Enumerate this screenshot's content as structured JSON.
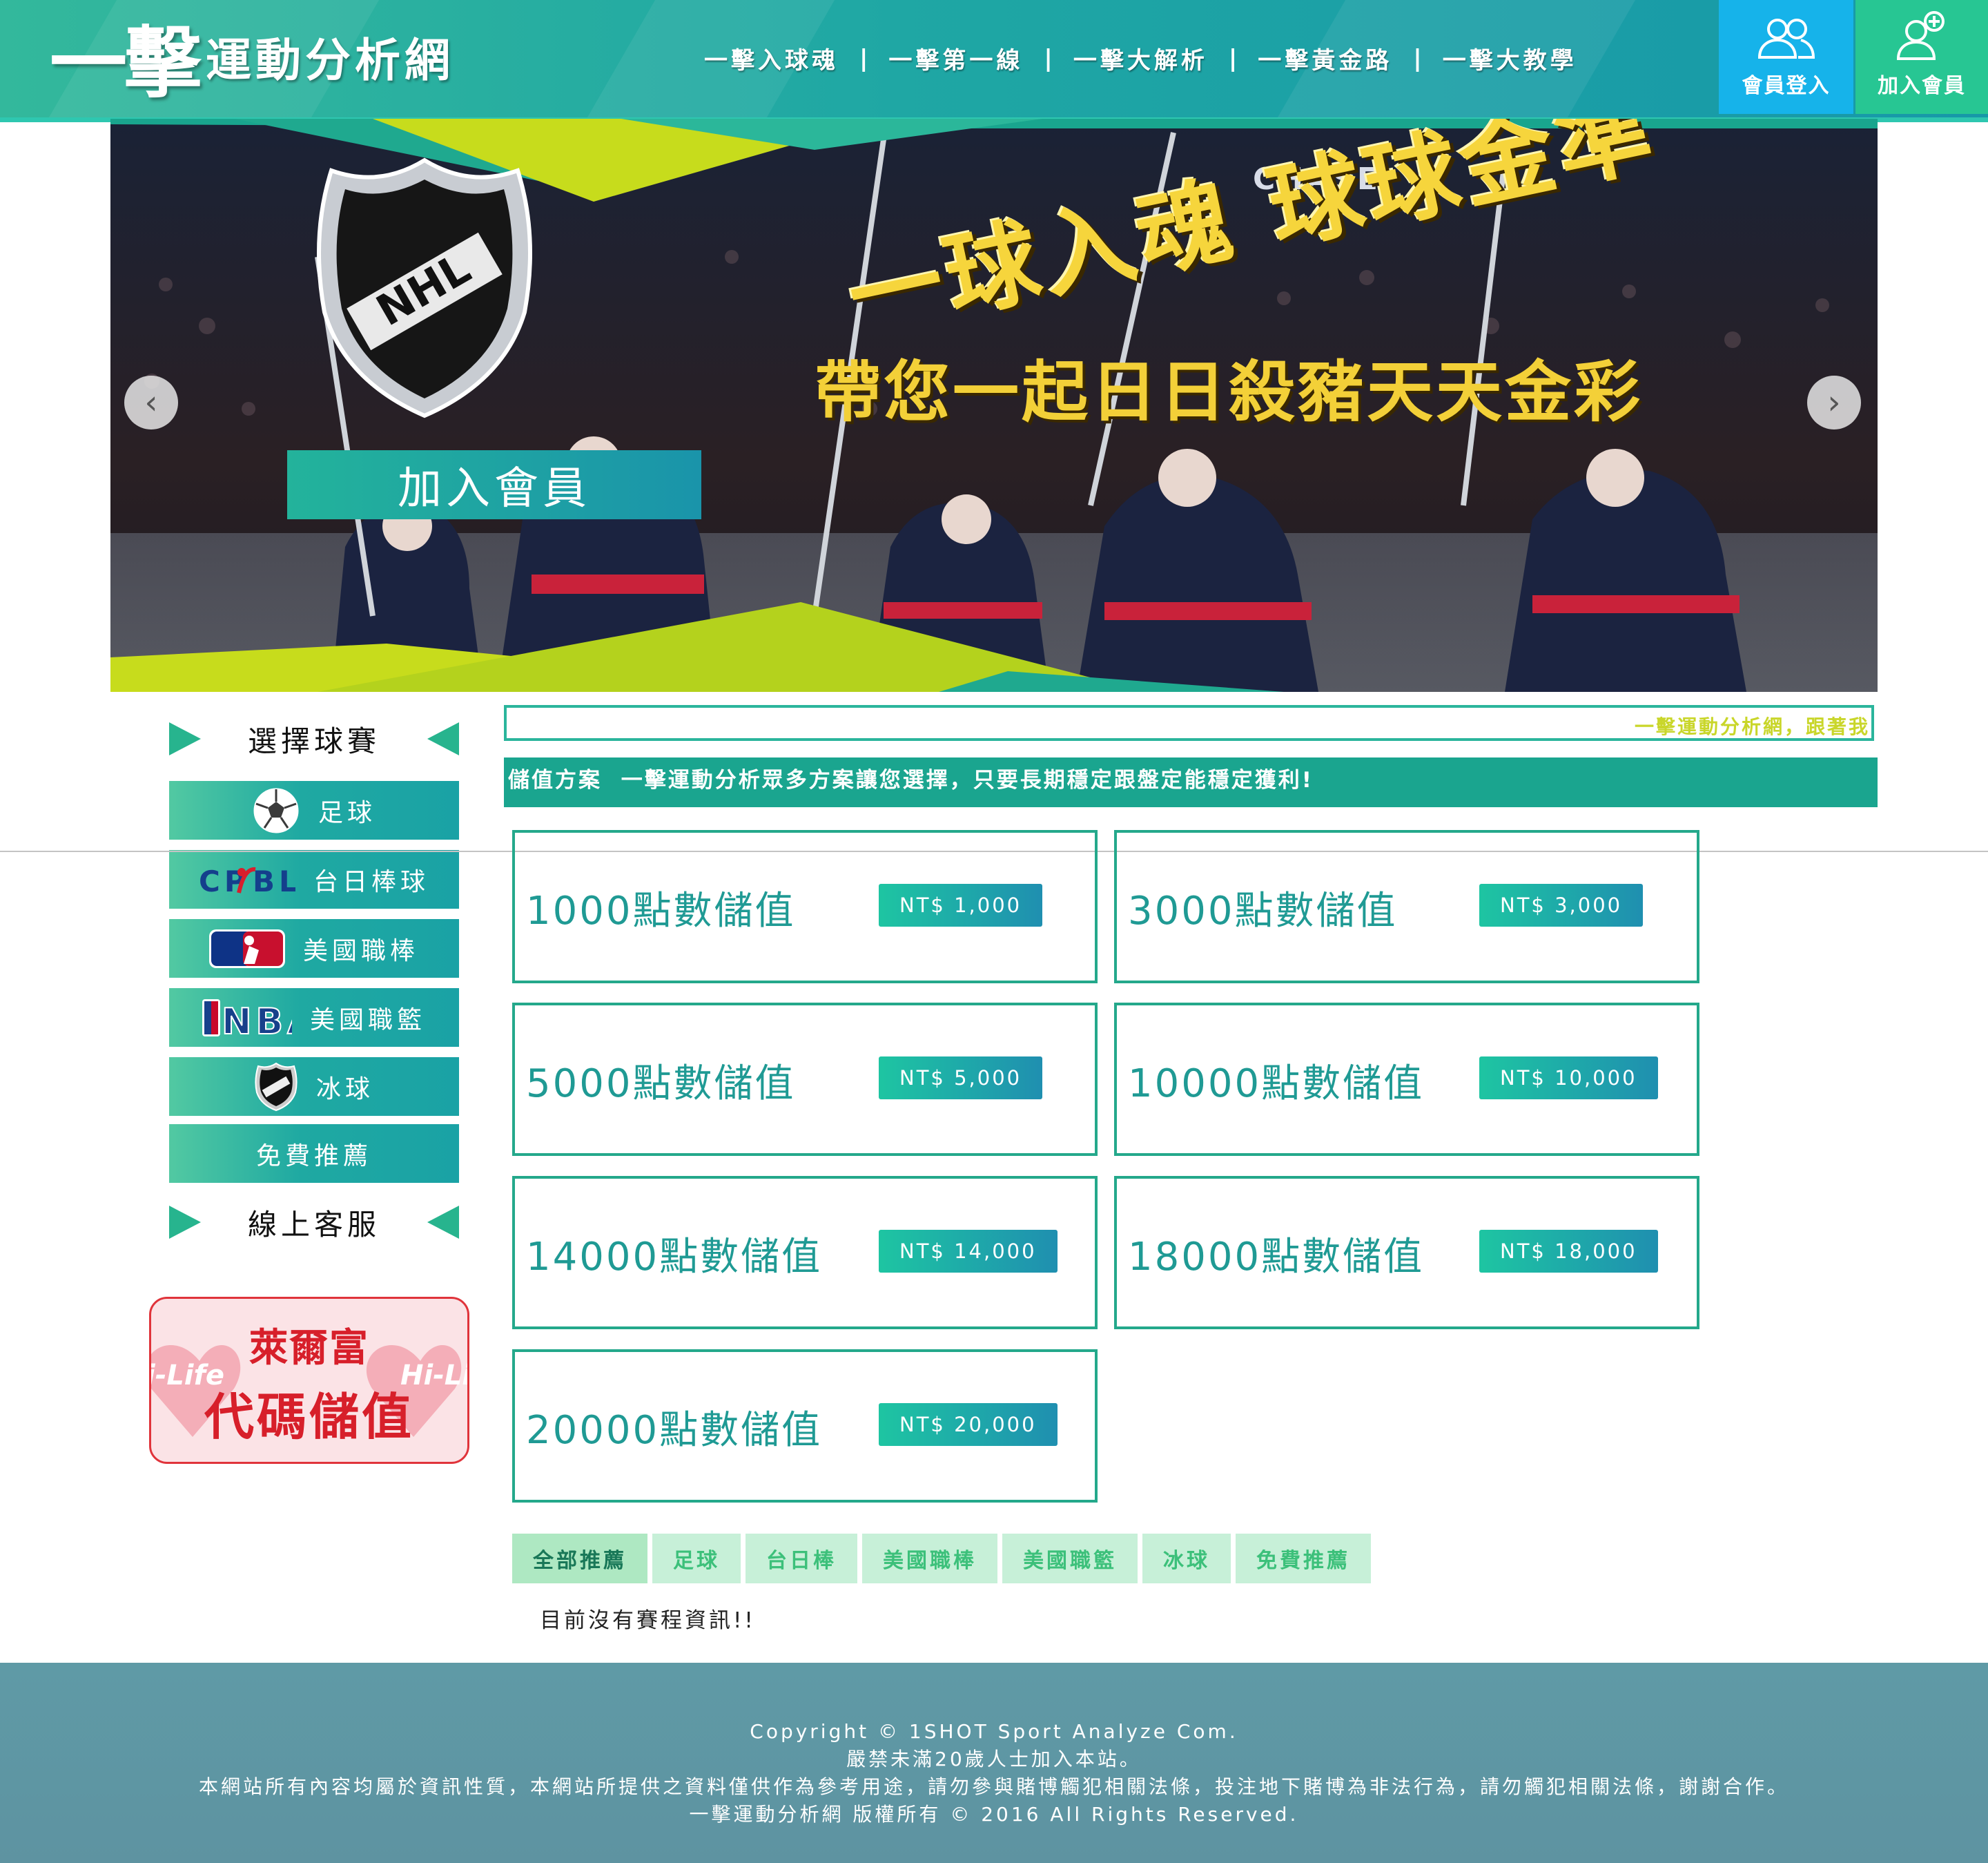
{
  "header": {
    "logo_big": "一擊",
    "logo_small": "運動分析網",
    "nav": [
      "一擊入球魂",
      "一擊第一線",
      "一擊大解析",
      "一擊黃金路",
      "一擊大教學"
    ],
    "nav_separator": "|",
    "login_label": "會員登入",
    "join_label": "加入會員",
    "login_bg": "#16b3ea",
    "join_bg": "#27c693"
  },
  "banner": {
    "cta_label": "加入會員",
    "slogan_line1": "一球入魂 球球金準",
    "slogan_line2": "帶您一起日日殺豬天天金彩",
    "sponsor": "CHASE",
    "league_logo": "NHL",
    "prev_arrow": "‹",
    "next_arrow": "›"
  },
  "sidebar": {
    "select_title": "選擇球賽",
    "sports": [
      {
        "label": "足球",
        "icon": "soccer-ball-icon"
      },
      {
        "label": "台日棒球",
        "icon": "cpbl-icon"
      },
      {
        "label": "美國職棒",
        "icon": "mlb-icon"
      },
      {
        "label": "美國職籃",
        "icon": "nba-icon"
      },
      {
        "label": "冰球",
        "icon": "nhl-icon"
      },
      {
        "label": "免費推薦",
        "icon": ""
      }
    ],
    "service_title": "線上客服",
    "hilife_brand": "萊爾富",
    "hilife_text": "代碼儲值",
    "hilife_side_left": "i-Life",
    "hilife_side_right": "Hi-Li"
  },
  "ticker": {
    "text": "一擊運動分析網，跟著我"
  },
  "plans": {
    "title": "儲值方案",
    "subtitle": "一擊運動分析眾多方案讓您選擇，只要長期穩定跟盤定能穩定獲利!",
    "items": [
      {
        "name": "1000點數儲值",
        "price": "NT$ 1,000"
      },
      {
        "name": "3000點數儲值",
        "price": "NT$ 3,000"
      },
      {
        "name": "5000點數儲值",
        "price": "NT$ 5,000"
      },
      {
        "name": "10000點數儲值",
        "price": "NT$ 10,000"
      },
      {
        "name": "14000點數儲值",
        "price": "NT$ 14,000"
      },
      {
        "name": "18000點數儲值",
        "price": "NT$ 18,000"
      },
      {
        "name": "20000點數儲值",
        "price": "NT$ 20,000"
      }
    ]
  },
  "filter_tabs": [
    "全部推薦",
    "足球",
    "台日棒",
    "美國職棒",
    "美國職籃",
    "冰球",
    "免費推薦"
  ],
  "active_tab": "全部推薦",
  "no_data": "目前沒有賽程資訊!!",
  "footer": {
    "line1": "Copyright © 1SHOT Sport Analyze Com.",
    "line2": "嚴禁未滿20歲人士加入本站。",
    "line3": "本網站所有內容均屬於資訊性質，本網站所提供之資料僅供作為參考用途，請勿參與賭博觸犯相關法條，投注地下賭博為非法行為，請勿觸犯相關法條，謝謝合作。",
    "line4": "一擊運動分析網 版權所有 © 2016 All Rights Reserved."
  }
}
